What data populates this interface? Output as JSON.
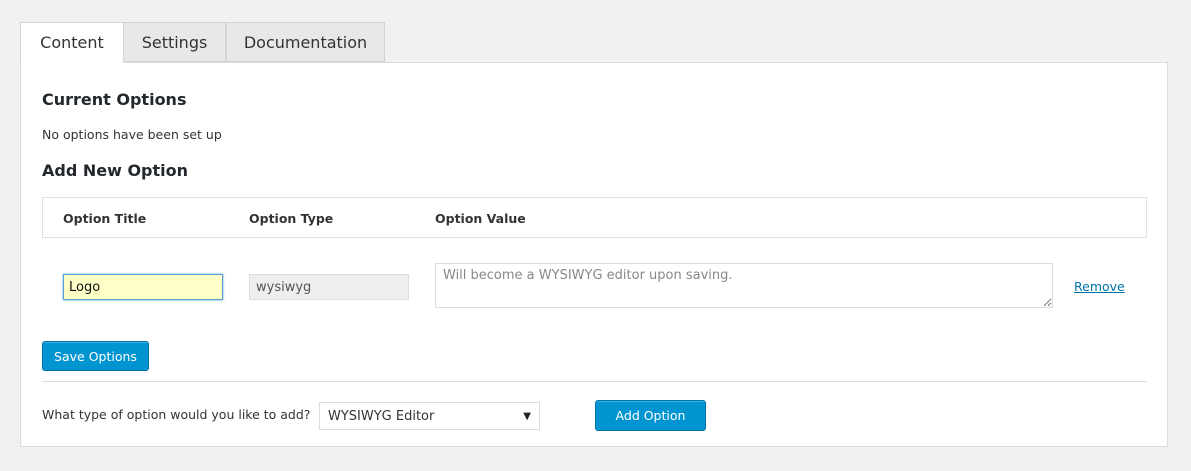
{
  "tabs": [
    {
      "label": "Content",
      "active": true
    },
    {
      "label": "Settings",
      "active": false
    },
    {
      "label": "Documentation",
      "active": false
    }
  ],
  "current_options": {
    "heading": "Current Options",
    "empty_message": "No options have been set up"
  },
  "add_new": {
    "heading": "Add New Option",
    "columns": [
      "Option Title",
      "Option Type",
      "Option Value"
    ],
    "row": {
      "title_value": "Logo",
      "type_value": "wysiwyg",
      "value_placeholder": "Will become a WYSIWYG editor upon saving.",
      "remove_label": "Remove"
    },
    "save_label": "Save Options"
  },
  "add_type": {
    "prompt": "What type of option would you like to add?",
    "selected": "WYSIWYG Editor",
    "caret": "▼",
    "button_label": "Add Option"
  },
  "colors": {
    "accent": "#0095d0",
    "link": "#0073aa",
    "focused_input_bg": "#ffffc8"
  }
}
